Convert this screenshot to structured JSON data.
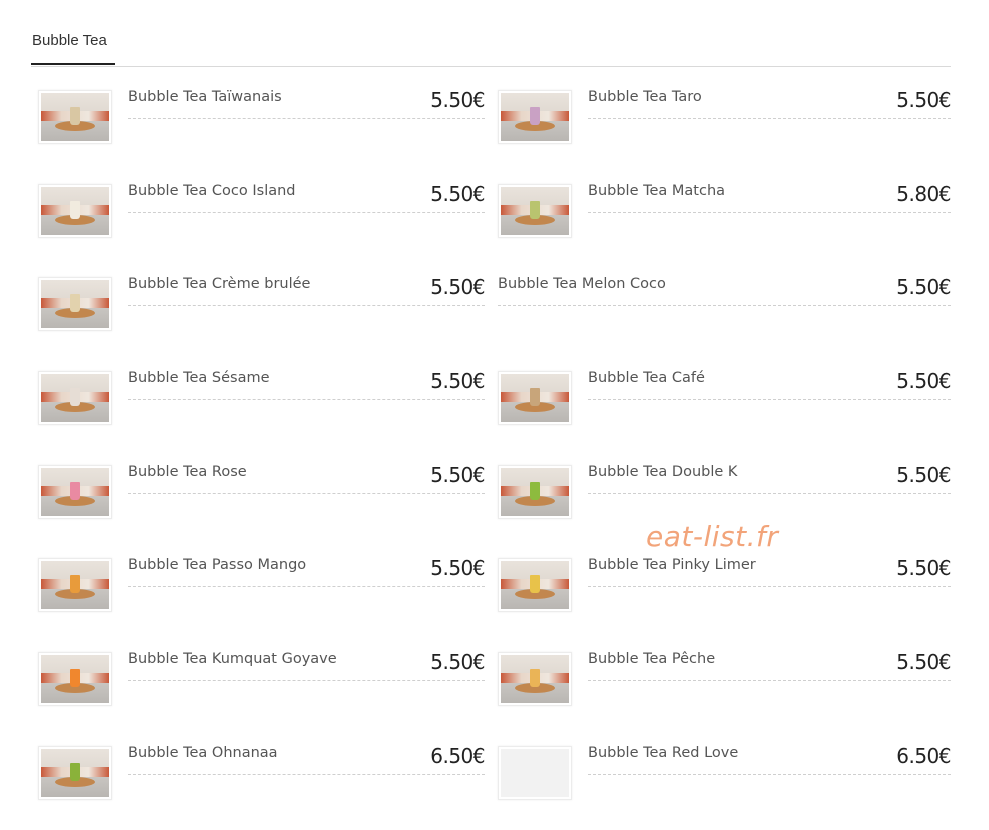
{
  "tabs": [
    {
      "label": "Bubble Tea",
      "active": true
    }
  ],
  "watermark": "eat-list.fr",
  "colors": {
    "watermark": "#f2a47a",
    "price": "#222222",
    "name": "#555555",
    "tab_underline": "#222222"
  },
  "items": [
    {
      "name": "Bubble Tea Taïwanais",
      "price": "5.50€",
      "drink_color": "#d9c7a3",
      "has_image": true
    },
    {
      "name": "Bubble Tea Taro",
      "price": "5.50€",
      "drink_color": "#c9a1c4",
      "has_image": true
    },
    {
      "name": "Bubble Tea Coco Island",
      "price": "5.50€",
      "drink_color": "#f1ebdf",
      "has_image": true
    },
    {
      "name": "Bubble Tea Matcha",
      "price": "5.80€",
      "drink_color": "#b9c46f",
      "has_image": true
    },
    {
      "name": "Bubble Tea Crème brulée",
      "price": "5.50€",
      "drink_color": "#e2d2ad",
      "has_image": true
    },
    {
      "name": "Bubble Tea Melon Coco",
      "price": "5.50€",
      "drink_color": "",
      "has_image": false
    },
    {
      "name": "Bubble Tea Sésame",
      "price": "5.50€",
      "drink_color": "#e6ddd5",
      "has_image": true
    },
    {
      "name": "Bubble Tea Café",
      "price": "5.50€",
      "drink_color": "#c8a57a",
      "has_image": true
    },
    {
      "name": "Bubble Tea Rose",
      "price": "5.50€",
      "drink_color": "#e98aa2",
      "has_image": true
    },
    {
      "name": "Bubble Tea Double K",
      "price": "5.50€",
      "drink_color": "#8dbb3e",
      "has_image": true
    },
    {
      "name": "Bubble Tea Passo Mango",
      "price": "5.50€",
      "drink_color": "#e89b3b",
      "has_image": true
    },
    {
      "name": "Bubble Tea Pinky Limer",
      "price": "5.50€",
      "drink_color": "#e8c24a",
      "has_image": true
    },
    {
      "name": "Bubble Tea Kumquat Goyave",
      "price": "5.50€",
      "drink_color": "#f0872e",
      "has_image": true
    },
    {
      "name": "Bubble Tea Pêche",
      "price": "5.50€",
      "drink_color": "#eab457",
      "has_image": true
    },
    {
      "name": "Bubble Tea Ohnanaa",
      "price": "6.50€",
      "drink_color": "#8ab23a",
      "has_image": true
    },
    {
      "name": "Bubble Tea Red Love",
      "price": "6.50€",
      "drink_color": "",
      "has_image": true
    }
  ]
}
